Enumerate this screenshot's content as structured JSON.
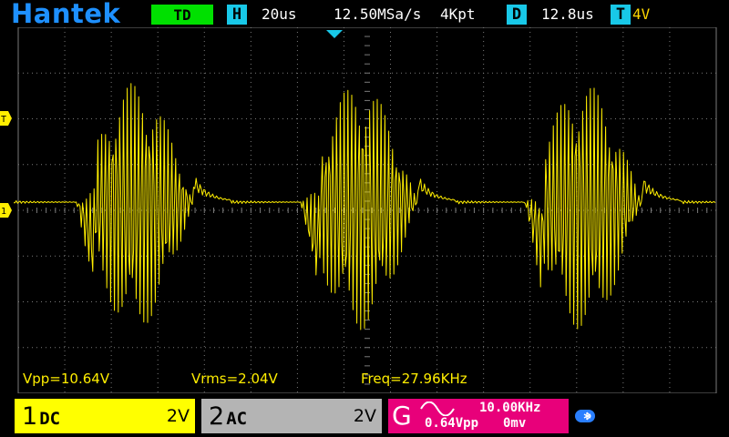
{
  "topbar": {
    "brand": "Hantek",
    "mode": "TD",
    "timebase_letter": "H",
    "timebase_value": "20us",
    "sample_rate": "12.50MSa/s",
    "memory_depth": "4Kpt",
    "delay_letter": "D",
    "delay_value": "12.8us",
    "trigger_letter": "T",
    "trigger_level": "4V"
  },
  "markers": {
    "trigger_marker": "T",
    "channel1_marker": "1"
  },
  "measurements": {
    "vpp": "Vpp=10.64V",
    "vrms": "Vrms=2.04V",
    "freq": "Freq=27.96KHz"
  },
  "channels": {
    "ch1": {
      "number": "1",
      "coupling": "DC",
      "volts_div": "2V"
    },
    "ch2": {
      "number": "2",
      "coupling": "AC",
      "volts_div": "2V"
    }
  },
  "generator": {
    "letter": "G",
    "waveform_icon": "sine-wave-icon",
    "frequency": "10.00KHz",
    "amplitude": "0.64Vpp",
    "offset": "0mv"
  },
  "colors": {
    "brand": "#1e90ff",
    "mode_badge": "#00e000",
    "letter_badge": "#18c8e8",
    "ch1": "#ffff00",
    "ch2": "#b4b4b4",
    "generator": "#e8007a",
    "trace": "#ffee00",
    "grid": "#7a7a7a"
  },
  "icons": {
    "bluetooth": "usb-bluetooth-icon"
  }
}
